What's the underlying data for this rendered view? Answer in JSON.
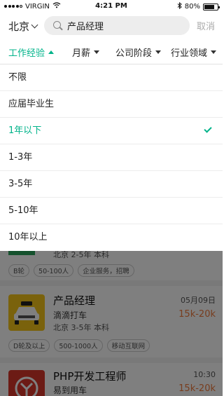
{
  "status_bar": {
    "carrier": "VIRGIN",
    "time": "4:21 PM",
    "battery": "80%",
    "battery_level": 0.8
  },
  "header": {
    "city": "北京",
    "search_value": "产品经理",
    "cancel_label": "取消"
  },
  "filters": {
    "tabs": [
      {
        "label": "工作经验",
        "active": true
      },
      {
        "label": "月薪",
        "active": false
      },
      {
        "label": "公司阶段",
        "active": false
      },
      {
        "label": "行业领域",
        "active": false
      }
    ]
  },
  "dropdown": {
    "options": [
      {
        "label": "不限",
        "selected": false
      },
      {
        "label": "应届毕业生",
        "selected": false
      },
      {
        "label": "1年以下",
        "selected": true
      },
      {
        "label": "1-3年",
        "selected": false
      },
      {
        "label": "3-5年",
        "selected": false
      },
      {
        "label": "5-10年",
        "selected": false
      },
      {
        "label": "10年以上",
        "selected": false
      }
    ]
  },
  "jobs": [
    {
      "meta": "北京  2-5年  本科",
      "tags": [
        "B轮",
        "50-100人",
        "企业服务，招聘"
      ]
    },
    {
      "title": "产品经理",
      "company": "滴滴打车",
      "meta": "北京  3-5年  本科",
      "date": "05月09日",
      "salary": "15k-20k",
      "tags": [
        "D轮及以上",
        "500-1000人",
        "移动互联网"
      ]
    },
    {
      "title": "PHP开发工程师",
      "company": "易到用车",
      "date": "10:30",
      "salary": "15k-20k"
    }
  ],
  "colors": {
    "accent": "#00b38a",
    "salary": "#f07a3c",
    "overlay": "rgba(0,0,0,0.5)"
  }
}
